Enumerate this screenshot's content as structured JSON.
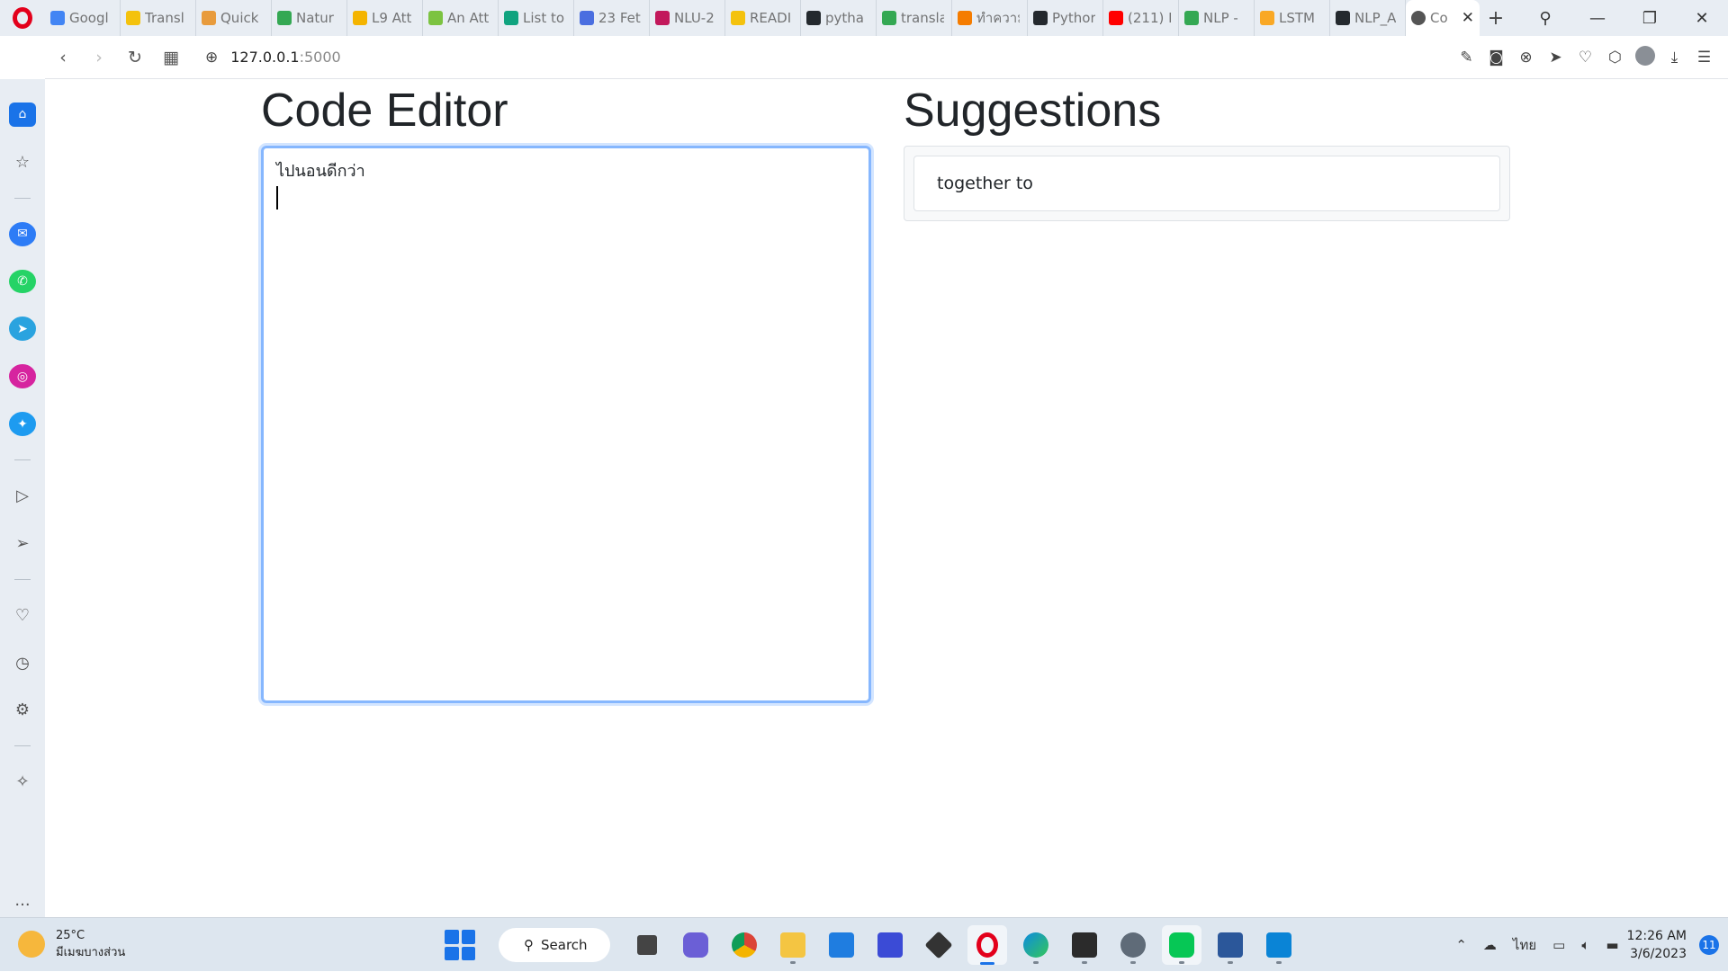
{
  "browser": {
    "tabs": [
      {
        "label": "Googl",
        "color": "#4285f4"
      },
      {
        "label": "Transl",
        "color": "#f4c20d"
      },
      {
        "label": "Quick",
        "color": "#e89b3c"
      },
      {
        "label": "Natur",
        "color": "#34a853"
      },
      {
        "label": "L9 Att",
        "color": "#f4b400"
      },
      {
        "label": "An Att",
        "color": "#7cc341"
      },
      {
        "label": "List to",
        "color": "#10a37f"
      },
      {
        "label": "23 Fet",
        "color": "#4a6ee0"
      },
      {
        "label": "NLU-2",
        "color": "#c2185b"
      },
      {
        "label": "READI",
        "color": "#f4c20d"
      },
      {
        "label": "pytha",
        "color": "#24292e"
      },
      {
        "label": "transla",
        "color": "#34a853"
      },
      {
        "label": "ทำความ",
        "color": "#f57c00"
      },
      {
        "label": "Pythor",
        "color": "#24292e"
      },
      {
        "label": "(211) L",
        "color": "#ff0000"
      },
      {
        "label": "NLP -",
        "color": "#34a853"
      },
      {
        "label": "LSTM",
        "color": "#f9a825"
      },
      {
        "label": "NLP_A",
        "color": "#24292e"
      }
    ],
    "active_tab": {
      "label": "Co",
      "close": "✕"
    },
    "new_tab": "+",
    "window_controls": {
      "search": "⚲",
      "minimize": "—",
      "restore": "❐",
      "close": "✕"
    },
    "nav": {
      "back": "‹",
      "forward": "›",
      "reload": "↻",
      "tabs_grid": "▦"
    },
    "url": {
      "host": "127.0.0.1",
      "port": ":5000"
    }
  },
  "page": {
    "editor_title": "Code Editor",
    "editor_text": "ไปนอนดีกว่า",
    "suggestions_title": "Suggestions",
    "suggestions": [
      "together to"
    ]
  },
  "taskbar": {
    "weather": {
      "temp": "25°C",
      "desc": "มีเมฆบางส่วน"
    },
    "search_label": "Search",
    "lang": "ไทย",
    "time": "12:26 AM",
    "date": "3/6/2023",
    "notifications": "11"
  },
  "colors": {
    "accent": "#1a73e8",
    "opera": "#e3001b",
    "focus": "#86b7fe"
  }
}
